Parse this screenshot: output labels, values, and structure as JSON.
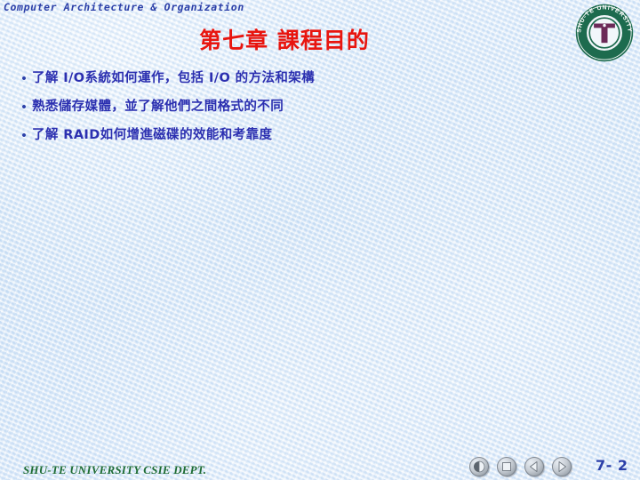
{
  "header": {
    "course_title": "Computer Architecture & Organization"
  },
  "title": {
    "text": "第七章  課程目的",
    "color": "#e8150f"
  },
  "bullets": [
    {
      "marker": "•",
      "text": "了解 I/O系統如何運作，包括  I/O 的方法和架構"
    },
    {
      "marker": "•",
      "text": "熟悉儲存媒體，並了解他們之間格式的不同"
    },
    {
      "marker": "•",
      "text": "了解 RAID如何增進磁碟的效能和考靠度"
    }
  ],
  "logo": {
    "name": "shu-te-university-seal",
    "ring_text": "SHU-TE UNIVERSITY",
    "ring_color": "#1d6b4e",
    "emblem_color": "#6b2a58"
  },
  "footer": {
    "department": "SHU-TE UNIVERSITY  CSIE DEPT.",
    "color": "#1d6b33"
  },
  "navigation": {
    "buttons": [
      {
        "name": "previous-slide-button",
        "icon": "back-half-circle-icon",
        "label": "Back"
      },
      {
        "name": "stop-button",
        "icon": "stop-square-icon",
        "label": "Stop"
      },
      {
        "name": "rewind-button",
        "icon": "triangle-left-icon",
        "label": "Rewind"
      },
      {
        "name": "forward-button",
        "icon": "triangle-right-icon",
        "label": "Forward"
      }
    ]
  },
  "page": {
    "number": "7- 2"
  },
  "theme": {
    "background": "#dde9f8",
    "accent_blue": "#2b3fa8",
    "body_blue": "#2b2fb0"
  }
}
